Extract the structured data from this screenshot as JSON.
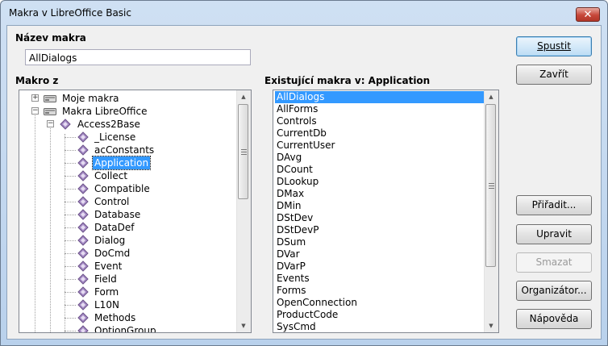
{
  "window": {
    "title": "Makra v LibreOffice Basic",
    "close_glyph": "✕"
  },
  "macro_name": {
    "label": "Název makra",
    "value": "AllDialogs"
  },
  "macro_from": {
    "label": "Makro z",
    "roots": [
      {
        "label": "Moje makra",
        "expander": "+"
      },
      {
        "label": "Makra LibreOffice",
        "expander": "−"
      }
    ],
    "library": {
      "label": "Access2Base",
      "expander": "−"
    },
    "modules": [
      "_License",
      "acConstants",
      "Application",
      "Collect",
      "Compatible",
      "Control",
      "Database",
      "DataDef",
      "Dialog",
      "DoCmd",
      "Event",
      "Field",
      "Form",
      "L10N",
      "Methods",
      "OptionGroup"
    ],
    "selected_module": "Application"
  },
  "existing": {
    "label": "Existující makra v: Application",
    "items": [
      "AllDialogs",
      "AllForms",
      "Controls",
      "CurrentDb",
      "CurrentUser",
      "DAvg",
      "DCount",
      "DLookup",
      "DMax",
      "DMin",
      "DStDev",
      "DStDevP",
      "DSum",
      "DVar",
      "DVarP",
      "Events",
      "Forms",
      "OpenConnection",
      "ProductCode",
      "SysCmd"
    ],
    "selected": "AllDialogs"
  },
  "buttons": {
    "run": "Spustit",
    "close": "Zavřít",
    "assign": "Přiřadit...",
    "edit": "Upravit",
    "delete": "Smazat",
    "organizer": "Organizátor...",
    "help": "Nápověda"
  },
  "colors": {
    "selection": "#3399ff",
    "icon_purple": "#a58bc4"
  }
}
